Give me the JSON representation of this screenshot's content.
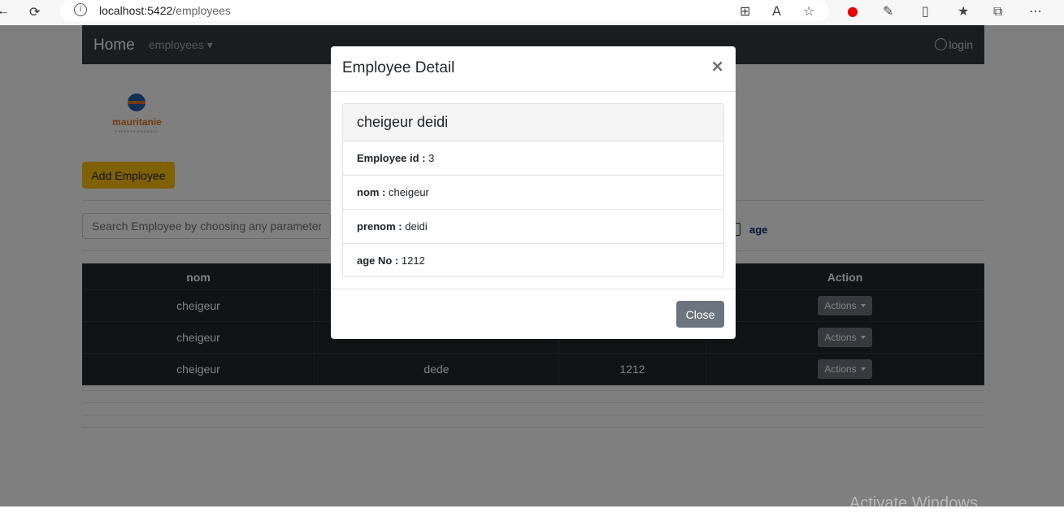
{
  "browser": {
    "url_host": "localhost:5422",
    "url_path": "/employees",
    "info_icon": "i"
  },
  "navbar": {
    "brand": "Home",
    "dropdown": "employees",
    "login": "login"
  },
  "logo": {
    "name": "mauritanie",
    "tagline": "EXPERTS GENERAL"
  },
  "add_button": "Add Employee",
  "search": {
    "placeholder": "Search Employee by choosing any parameter"
  },
  "filter": {
    "age_label": "age"
  },
  "table": {
    "headers": [
      "nom",
      "",
      "",
      "Action"
    ],
    "rows": [
      {
        "nom": "cheigeur",
        "prenom": "",
        "age": "",
        "action": "Actions"
      },
      {
        "nom": "cheigeur",
        "prenom": "",
        "age": "",
        "action": "Actions"
      },
      {
        "nom": "cheigeur",
        "prenom": "dede",
        "age": "1212",
        "action": "Actions"
      }
    ]
  },
  "modal": {
    "title": "Employee Detail",
    "close_x": "×",
    "card_title": "cheigeur deidi",
    "fields": [
      {
        "label": "Employee id :",
        "value": "3"
      },
      {
        "label": "nom :",
        "value": "cheigeur"
      },
      {
        "label": "prenom :",
        "value": "deidi"
      },
      {
        "label": "age No :",
        "value": "1212"
      }
    ],
    "close_button": "Close"
  },
  "watermark": "Activate Windows"
}
